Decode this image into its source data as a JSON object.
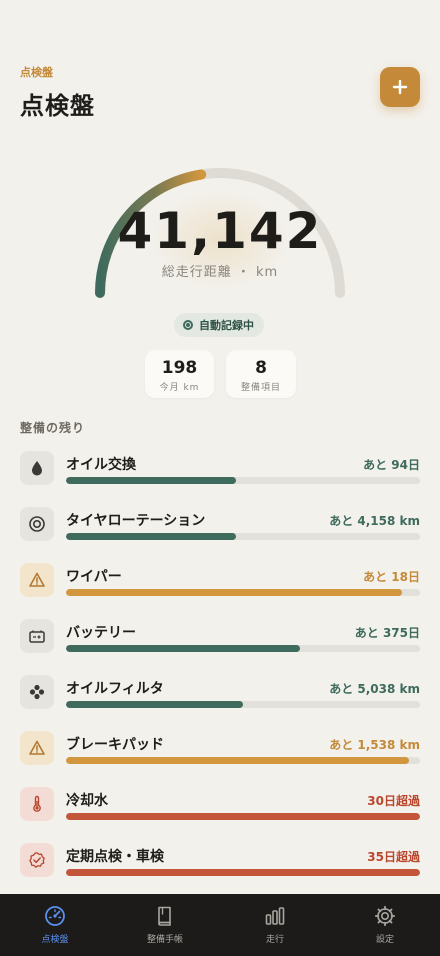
{
  "header": {
    "eyebrow": "点検盤",
    "title": "点検盤"
  },
  "add_button": {
    "icon": "plus-icon"
  },
  "gauge": {
    "value": "41,142",
    "caption": "総走行距離 ・ km",
    "progress": 0.45
  },
  "status": {
    "label": "自動記録中"
  },
  "stats": [
    {
      "value": "198",
      "label": "今月 km"
    },
    {
      "value": "8",
      "label": "整備項目"
    }
  ],
  "section_title": "整備の残り",
  "maintenance": [
    {
      "name": "オイル交換",
      "remaining": "あと 94日",
      "progress": 0.48,
      "status": "ok",
      "icon": "drop-icon"
    },
    {
      "name": "タイヤローテーション",
      "remaining": "あと 4,158 km",
      "progress": 0.48,
      "status": "ok",
      "icon": "tire-icon"
    },
    {
      "name": "ワイパー",
      "remaining": "あと 18日",
      "progress": 0.95,
      "status": "warn",
      "icon": "warning-icon"
    },
    {
      "name": "バッテリー",
      "remaining": "あと 375日",
      "progress": 0.66,
      "status": "ok",
      "icon": "battery-icon"
    },
    {
      "name": "オイルフィルタ",
      "remaining": "あと 5,038 km",
      "progress": 0.5,
      "status": "ok",
      "icon": "filter-icon"
    },
    {
      "name": "ブレーキパッド",
      "remaining": "あと 1,538 km",
      "progress": 0.97,
      "status": "warn",
      "icon": "warning-icon"
    },
    {
      "name": "冷却水",
      "remaining": "30日超過",
      "progress": 1.0,
      "status": "over",
      "icon": "thermometer-icon"
    },
    {
      "name": "定期点検・車検",
      "remaining": "35日超過",
      "progress": 1.0,
      "status": "over",
      "icon": "badge-check-icon"
    }
  ],
  "colors": {
    "ok": "#3e6b5d",
    "warn": "#d2963e",
    "over": "#c2553a",
    "ok_text": "#3e6b5d",
    "warn_text": "#c48a3a",
    "over_text": "#b9472e",
    "ok_bg": "#e6e4df",
    "warn_bg": "#f3e4cc",
    "over_bg": "#f3dcd5",
    "accent": "#c48a3a",
    "tab_active": "#5b8ff0"
  },
  "tabs": [
    {
      "label": "点検盤",
      "icon": "gauge-icon",
      "active": true
    },
    {
      "label": "整備手帳",
      "icon": "book-icon",
      "active": false
    },
    {
      "label": "走行",
      "icon": "bar-chart-icon",
      "active": false
    },
    {
      "label": "設定",
      "icon": "gear-icon",
      "active": false
    }
  ]
}
